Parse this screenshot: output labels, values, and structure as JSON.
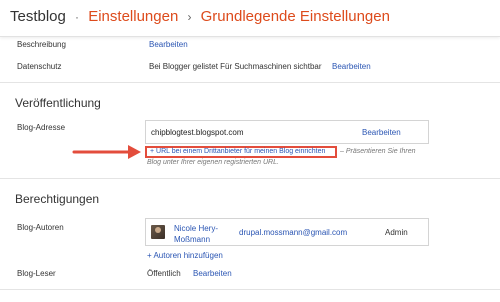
{
  "header": {
    "blog_name": "Testblog",
    "separator1": "·",
    "section": "Einstellungen",
    "separator2": "›",
    "page": "Grundlegende Einstellungen"
  },
  "rows": {
    "beschreibung": {
      "label": "Beschreibung",
      "action": "Bearbeiten"
    },
    "datenschutz": {
      "label": "Datenschutz",
      "value": "Bei Blogger gelistet Für Suchmaschinen sichtbar",
      "action": "Bearbeiten"
    }
  },
  "publishing": {
    "heading": "Veröffentlichung",
    "blog_address_label": "Blog-Adresse",
    "blog_url": "chipblogtest.blogspot.com",
    "edit_label": "Bearbeiten",
    "custom_domain_link": "+ URL bei einem Drittanbieter für meinen Blog einrichten",
    "hint_line1": "– Präsentieren Sie Ihren",
    "hint_line2": "Blog unter Ihrer eigenen registrierten URL."
  },
  "permissions": {
    "heading": "Berechtigungen",
    "authors_label": "Blog-Autoren",
    "author": {
      "name": "Nicole Hery-Moßmann",
      "email": "drupal.mossmann@gmail.com",
      "role": "Admin"
    },
    "add_authors": "+ Autoren hinzufügen",
    "readers_label": "Blog-Leser",
    "readers_value": "Öffentlich",
    "readers_action": "Bearbeiten"
  },
  "colors": {
    "accent_orange": "#dd4b1c",
    "link_blue": "#2a55b3",
    "highlight_red": "#e34d3c"
  }
}
